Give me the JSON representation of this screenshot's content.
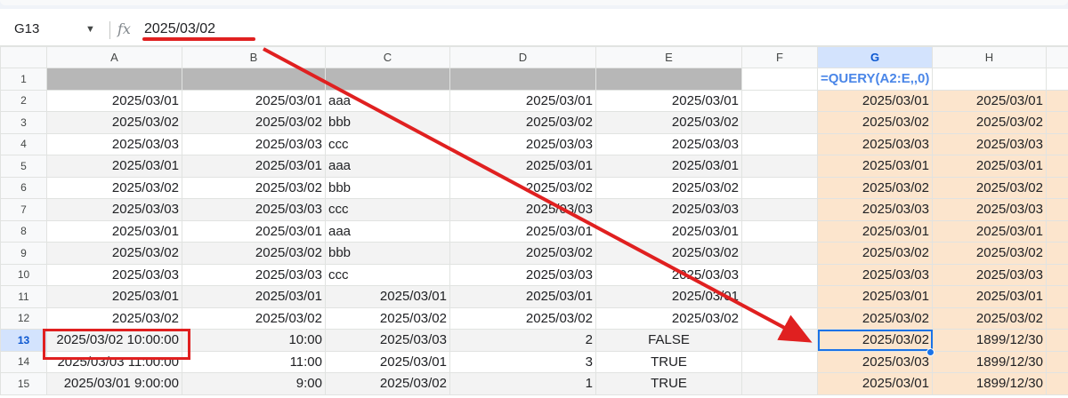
{
  "formula_bar": {
    "cell_ref": "G13",
    "caret_icon": "dropdown-caret-icon",
    "fx_label": "fx",
    "value": "2025/03/02"
  },
  "columns": [
    "A",
    "B",
    "C",
    "D",
    "E",
    "F",
    "G",
    "H"
  ],
  "row_numbers": [
    "1",
    "2",
    "3",
    "4",
    "5",
    "6",
    "7",
    "8",
    "9",
    "10",
    "11",
    "12",
    "13",
    "14",
    "15"
  ],
  "rows": [
    {
      "a": "",
      "b": "",
      "c": "",
      "d": "",
      "e": "",
      "f": "",
      "g": "=QUERY(A2:E,,0)",
      "h": ""
    },
    {
      "a": "2025/03/01",
      "b": "2025/03/01",
      "c": "aaa",
      "d": "2025/03/01",
      "e": "2025/03/01",
      "f": "",
      "g": "2025/03/01",
      "h": "2025/03/01"
    },
    {
      "a": "2025/03/02",
      "b": "2025/03/02",
      "c": "bbb",
      "d": "2025/03/02",
      "e": "2025/03/02",
      "f": "",
      "g": "2025/03/02",
      "h": "2025/03/02"
    },
    {
      "a": "2025/03/03",
      "b": "2025/03/03",
      "c": "ccc",
      "d": "2025/03/03",
      "e": "2025/03/03",
      "f": "",
      "g": "2025/03/03",
      "h": "2025/03/03"
    },
    {
      "a": "2025/03/01",
      "b": "2025/03/01",
      "c": "aaa",
      "d": "2025/03/01",
      "e": "2025/03/01",
      "f": "",
      "g": "2025/03/01",
      "h": "2025/03/01"
    },
    {
      "a": "2025/03/02",
      "b": "2025/03/02",
      "c": "bbb",
      "d": "2025/03/02",
      "e": "2025/03/02",
      "f": "",
      "g": "2025/03/02",
      "h": "2025/03/02"
    },
    {
      "a": "2025/03/03",
      "b": "2025/03/03",
      "c": "ccc",
      "d": "2025/03/03",
      "e": "2025/03/03",
      "f": "",
      "g": "2025/03/03",
      "h": "2025/03/03"
    },
    {
      "a": "2025/03/01",
      "b": "2025/03/01",
      "c": "aaa",
      "d": "2025/03/01",
      "e": "2025/03/01",
      "f": "",
      "g": "2025/03/01",
      "h": "2025/03/01"
    },
    {
      "a": "2025/03/02",
      "b": "2025/03/02",
      "c": "bbb",
      "d": "2025/03/02",
      "e": "2025/03/02",
      "f": "",
      "g": "2025/03/02",
      "h": "2025/03/02"
    },
    {
      "a": "2025/03/03",
      "b": "2025/03/03",
      "c": "ccc",
      "d": "2025/03/03",
      "e": "2025/03/03",
      "f": "",
      "g": "2025/03/03",
      "h": "2025/03/03"
    },
    {
      "a": "2025/03/01",
      "b": "2025/03/01",
      "c": "2025/03/01",
      "d": "2025/03/01",
      "e": "2025/03/01",
      "f": "",
      "g": "2025/03/01",
      "h": "2025/03/01"
    },
    {
      "a": "2025/03/02",
      "b": "2025/03/02",
      "c": "2025/03/02",
      "d": "2025/03/02",
      "e": "2025/03/02",
      "f": "",
      "g": "2025/03/02",
      "h": "2025/03/02"
    },
    {
      "a": "2025/03/02 10:00:00",
      "b": "10:00",
      "c": "2025/03/03",
      "d": "2",
      "e": "FALSE",
      "f": "",
      "g": "2025/03/02",
      "h": "1899/12/30"
    },
    {
      "a": "2025/03/03 11:00:00",
      "b": "11:00",
      "c": "2025/03/01",
      "d": "3",
      "e": "TRUE",
      "f": "",
      "g": "2025/03/03",
      "h": "1899/12/30"
    },
    {
      "a": "2025/03/01 9:00:00",
      "b": "9:00",
      "c": "2025/03/02",
      "d": "1",
      "e": "TRUE",
      "f": "",
      "g": "2025/03/01",
      "h": "1899/12/30"
    }
  ],
  "colors": {
    "annotation_red": "#e02020",
    "selection_blue": "#1a73e8",
    "query_result_fill": "#fce5cd",
    "formula_text": "#4a86e8"
  }
}
